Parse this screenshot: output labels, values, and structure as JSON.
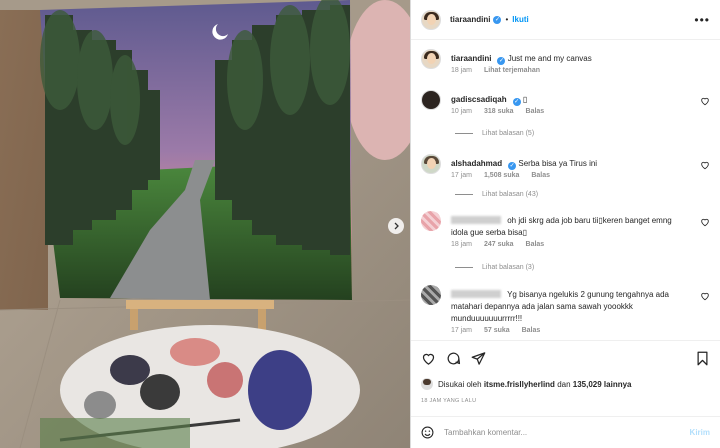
{
  "post": {
    "username": "tiaraandini",
    "follow_label": "Ikuti",
    "more_label": "•••",
    "caption": "Just me and my canvas",
    "caption_time": "18 jam",
    "translate_label": "Lihat terjemahan"
  },
  "comments": [
    {
      "username": "gadiscsadiqah",
      "text": "▯",
      "time": "10 jam",
      "likes": "318 suka",
      "reply": "Balas",
      "view_replies": "Lihat balasan (5)"
    },
    {
      "username": "alshadahmad",
      "text": "Serba bisa ya Tirus ini",
      "time": "17 jam",
      "likes": "1,508 suka",
      "reply": "Balas",
      "view_replies": "Lihat balasan (43)"
    },
    {
      "username": "",
      "text": "oh jdi skrg ada job baru tii▯keren banget emng idola gue serba bisa▯",
      "time": "18 jam",
      "likes": "247 suka",
      "reply": "Balas",
      "view_replies": "Lihat balasan (3)"
    },
    {
      "username": "",
      "text": "Yg bisanya ngelukis 2 gunung tengahnya ada matahari depannya ada jalan sama sawah yoookkk munduuuuuuurrrrr!!!",
      "time": "17 jam",
      "likes": "57 suka",
      "reply": "Balas"
    }
  ],
  "likes": {
    "prefix": "Disukai oleh",
    "user": "itsme.frisllyherlind",
    "conj": "dan",
    "count": "135,029 lainnya"
  },
  "timestamp": "18 JAM YANG LALU",
  "comment_input": {
    "placeholder": "Tambahkan komentar...",
    "post_label": "Kirim"
  },
  "icons": {
    "next": "chevron-right-icon",
    "like": "heart-icon",
    "comment": "speech-bubble-icon",
    "share": "paper-plane-icon",
    "save": "bookmark-icon",
    "emoji": "smiley-icon"
  },
  "colors": {
    "link_blue": "#0095f6",
    "verified_blue": "#3897f0",
    "muted_text": "#8e8e8e",
    "post_button_disabled": "#b2dffc"
  }
}
